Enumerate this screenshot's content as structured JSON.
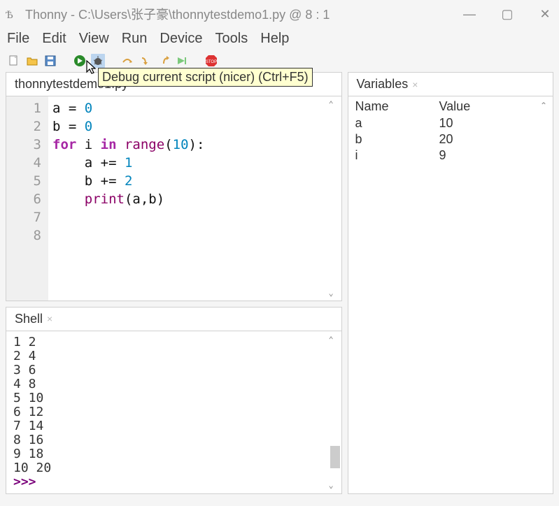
{
  "window": {
    "title": "Thonny  -  C:\\Users\\张子豪\\thonnytestdemo1.py  @  8 : 1"
  },
  "menu": [
    "File",
    "Edit",
    "View",
    "Run",
    "Device",
    "Tools",
    "Help"
  ],
  "tooltip": "Debug current script (nicer) (Ctrl+F5)",
  "editor": {
    "tab_name": "thonnytestdemo1.py",
    "line_count": 8,
    "code_tokens": [
      [
        {
          "t": "a ",
          "c": "var"
        },
        {
          "t": "= ",
          "c": "var"
        },
        {
          "t": "0",
          "c": "num"
        }
      ],
      [
        {
          "t": "b ",
          "c": "var"
        },
        {
          "t": "= ",
          "c": "var"
        },
        {
          "t": "0",
          "c": "num"
        }
      ],
      [
        {
          "t": "for ",
          "c": "kw"
        },
        {
          "t": "i ",
          "c": "var"
        },
        {
          "t": "in ",
          "c": "kw"
        },
        {
          "t": "range",
          "c": "fn"
        },
        {
          "t": "(",
          "c": "var"
        },
        {
          "t": "10",
          "c": "num"
        },
        {
          "t": "):",
          "c": "var"
        }
      ],
      [
        {
          "t": "    a += ",
          "c": "var"
        },
        {
          "t": "1",
          "c": "num"
        }
      ],
      [
        {
          "t": "    b += ",
          "c": "var"
        },
        {
          "t": "2",
          "c": "num"
        }
      ],
      [
        {
          "t": "    ",
          "c": "var"
        },
        {
          "t": "print",
          "c": "fn"
        },
        {
          "t": "(a,b)",
          "c": "var"
        }
      ],
      [],
      []
    ]
  },
  "shell": {
    "tab_name": "Shell",
    "lines": [
      "1 2",
      "2 4",
      "3 6",
      "4 8",
      "5 10",
      "6 12",
      "7 14",
      "8 16",
      "9 18",
      "10 20"
    ],
    "prompt": ">>>"
  },
  "variables": {
    "tab_name": "Variables",
    "header_name": "Name",
    "header_value": "Value",
    "rows": [
      {
        "name": "a",
        "value": "10"
      },
      {
        "name": "b",
        "value": "20"
      },
      {
        "name": "i",
        "value": "9"
      }
    ]
  }
}
